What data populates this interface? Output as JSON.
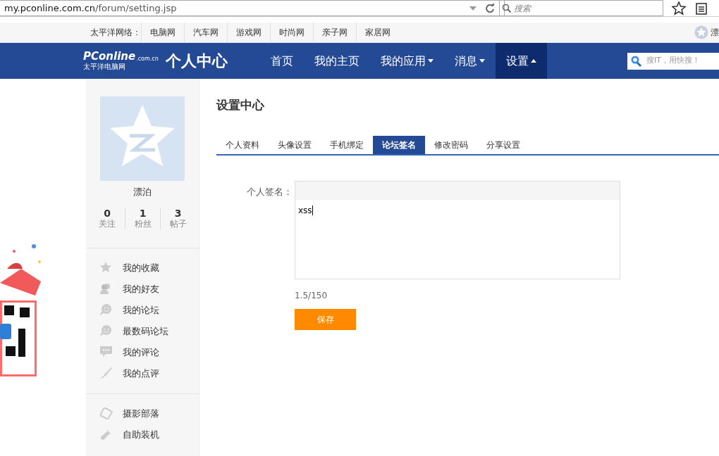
{
  "browser": {
    "url_host": "my.pconline.com.cn",
    "url_path": "/forum/setting.jsp",
    "search_placeholder": "搜索"
  },
  "network_bar": {
    "label": "太平洋网络：",
    "links": [
      "电脑网",
      "汽车网",
      "游戏网",
      "时尚网",
      "亲子网",
      "家居网"
    ],
    "user": "漂"
  },
  "header": {
    "logo": {
      "name": "PConline",
      "domain": ".com.cn",
      "tagline": "太平洋电脑网"
    },
    "title": "个人中心",
    "nav": [
      {
        "label": "首页",
        "selected": false,
        "dropdown": false,
        "expanded": false
      },
      {
        "label": "我的主页",
        "selected": false,
        "dropdown": false,
        "expanded": false
      },
      {
        "label": "我的应用",
        "selected": false,
        "dropdown": true,
        "expanded": false
      },
      {
        "label": "消息",
        "selected": false,
        "dropdown": true,
        "expanded": false
      },
      {
        "label": "设置",
        "selected": true,
        "dropdown": true,
        "expanded": true
      }
    ],
    "search_placeholder": "搜IT，用快搜！"
  },
  "sidebar": {
    "username": "漂泊",
    "stats": [
      {
        "value": "0",
        "label": "关注"
      },
      {
        "value": "1",
        "label": "粉丝"
      },
      {
        "value": "3",
        "label": "帖子"
      }
    ],
    "groups": [
      [
        "我的收藏",
        "我的好友",
        "我的论坛",
        "最数码论坛",
        "我的评论",
        "我的点评"
      ],
      [
        "摄影部落",
        "自助装机"
      ]
    ]
  },
  "main": {
    "title": "设置中心",
    "tabs": [
      {
        "label": "个人资料",
        "selected": false
      },
      {
        "label": "头像设置",
        "selected": false
      },
      {
        "label": "手机绑定",
        "selected": false
      },
      {
        "label": "论坛签名",
        "selected": true
      },
      {
        "label": "修改密码",
        "selected": false
      },
      {
        "label": "分享设置",
        "selected": false
      }
    ],
    "form": {
      "label": "个人签名：",
      "value": "xss",
      "counter": "1.5/150",
      "save": "保存"
    }
  }
}
